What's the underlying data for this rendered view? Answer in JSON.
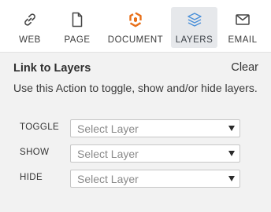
{
  "tabs": [
    {
      "label": "WEB",
      "icon": "link-icon"
    },
    {
      "label": "PAGE",
      "icon": "page-icon"
    },
    {
      "label": "DOCUMENT",
      "icon": "document-icon"
    },
    {
      "label": "LAYERS",
      "icon": "layers-icon",
      "active": true
    },
    {
      "label": "EMAIL",
      "icon": "email-icon"
    }
  ],
  "panel": {
    "title": "Link to Layers",
    "clear_label": "Clear",
    "description": "Use this Action to toggle, show and/or hide layers."
  },
  "rows": [
    {
      "label": "TOGGLE",
      "placeholder": "Select Layer"
    },
    {
      "label": "SHOW",
      "placeholder": "Select Layer"
    },
    {
      "label": "HIDE",
      "placeholder": "Select Layer"
    }
  ],
  "colors": {
    "document_icon": "#e8701a",
    "layers_icon": "#4a90d9",
    "active_tab_bg": "#e6e8eb",
    "panel_bg": "#f2f2f2"
  }
}
